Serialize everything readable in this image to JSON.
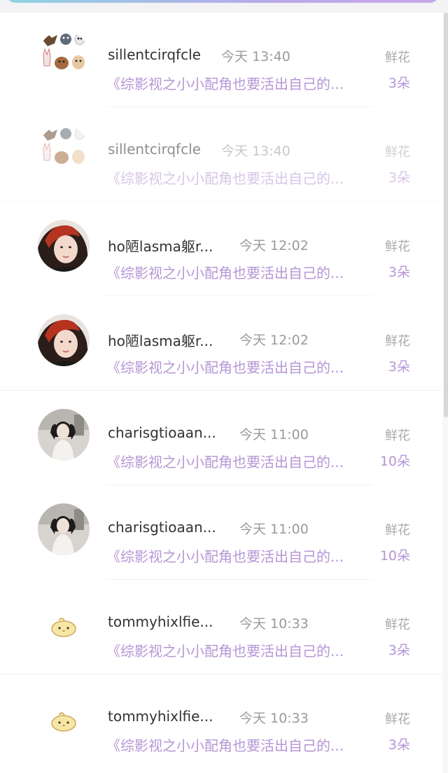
{
  "gifts": [
    {
      "user": "sillentcirqfcle",
      "time": "今天 13:40",
      "gift_label": "鲜花",
      "message": "《综影视之小小配角也要活出自己的...",
      "count": "3朵",
      "avatar": "stickers-avatar"
    },
    {
      "user": "sillentcirqfcle",
      "time": "今天 13:40",
      "gift_label": "鲜花",
      "message": "《综影视之小小配角也要活出自己的...",
      "count": "3朵",
      "avatar": "stickers-avatar"
    },
    {
      "user": "ho陋lasma躯r...",
      "time": "今天 12:02",
      "gift_label": "鲜花",
      "message": "《综影视之小小配角也要活出自己的...",
      "count": "3朵",
      "avatar": "portrait-red-hair-avatar"
    },
    {
      "user": "ho陋lasma躯r...",
      "time": "今天 12:02",
      "gift_label": "鲜花",
      "message": "《综影视之小小配角也要活出自己的...",
      "count": "3朵",
      "avatar": "portrait-red-hair-avatar"
    },
    {
      "user": "charisgtioaan...",
      "time": "今天 11:00",
      "gift_label": "鲜花",
      "message": "《综影视之小小配角也要活出自己的...",
      "count": "10朵",
      "avatar": "girl-photo-avatar"
    },
    {
      "user": "charisgtioaan...",
      "time": "今天 11:00",
      "gift_label": "鲜花",
      "message": "《综影视之小小配角也要活出自己的...",
      "count": "10朵",
      "avatar": "girl-photo-avatar"
    },
    {
      "user": "tommyhixlfie...",
      "time": "今天 10:33",
      "gift_label": "鲜花",
      "message": "《综影视之小小配角也要活出自己的...",
      "count": "3朵",
      "avatar": "yellow-blob-avatar"
    },
    {
      "user": "tommyhixlfie...",
      "time": "今天 10:33",
      "gift_label": "鲜花",
      "message": "《综影视之小小配角也要活出自己的...",
      "count": "3朵",
      "avatar": "yellow-blob-avatar"
    }
  ],
  "colors": {
    "accent_purple": "#b596d6",
    "name_text": "#333333",
    "meta_text": "#9a9a9a"
  }
}
